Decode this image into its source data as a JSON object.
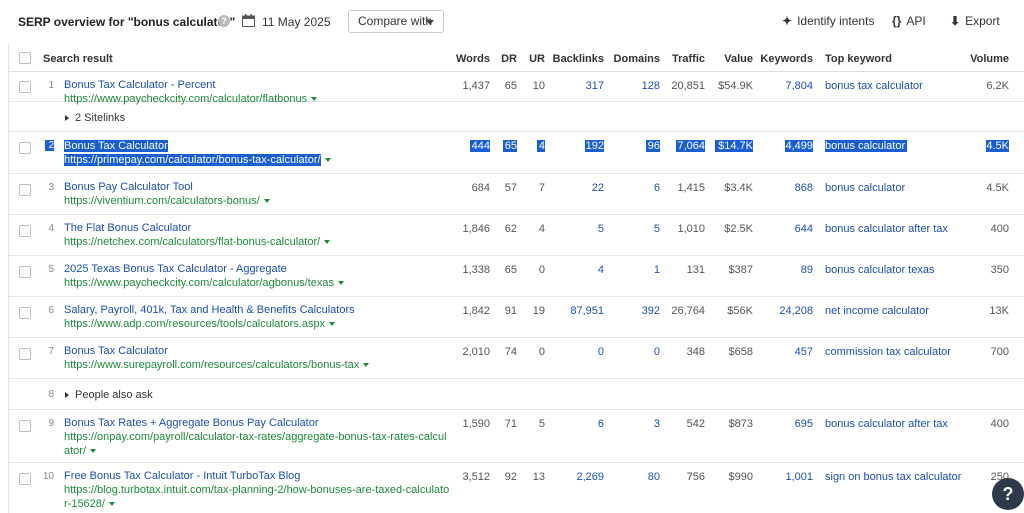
{
  "header": {
    "title": "SERP overview for \"bonus calculator\"",
    "help_icon": "?",
    "date": "11 May 2025",
    "compare_label": "Compare with",
    "identify_label": "Identify intents",
    "api_label": "API",
    "export_label": "Export"
  },
  "columns": {
    "result": "Search result",
    "words": "Words",
    "dr": "DR",
    "ur": "UR",
    "backlinks": "Backlinks",
    "domains": "Domains",
    "traffic": "Traffic",
    "value": "Value",
    "keywords": "Keywords",
    "top_keyword": "Top keyword",
    "volume": "Volume"
  },
  "rows": [
    {
      "rank": "1",
      "title": "Bonus Tax Calculator - Percent",
      "url": "https://www.paycheckcity.com/calculator/flatbonus",
      "words": "1,437",
      "dr": "65",
      "ur": "10",
      "backlinks": "317",
      "domains": "128",
      "traffic": "20,851",
      "value": "$54.9K",
      "keywords": "7,804",
      "top_keyword": "bonus tax calculator",
      "volume": "6.2K"
    },
    {
      "sitelinks": "2 Sitelinks"
    },
    {
      "rank": "2",
      "title": "Bonus Tax Calculator",
      "url": "https://primepay.com/calculator/bonus-tax-calculator/",
      "words": "444",
      "dr": "65",
      "ur": "4",
      "backlinks": "192",
      "domains": "96",
      "traffic": "7,064",
      "value": "$14.7K",
      "keywords": "4,499",
      "top_keyword": "bonus calculator",
      "volume": "4.5K"
    },
    {
      "rank": "3",
      "title": "Bonus Pay Calculator Tool",
      "url": "https://viventium.com/calculators-bonus/",
      "words": "684",
      "dr": "57",
      "ur": "7",
      "backlinks": "22",
      "domains": "6",
      "traffic": "1,415",
      "value": "$3.4K",
      "keywords": "868",
      "top_keyword": "bonus calculator",
      "volume": "4.5K"
    },
    {
      "rank": "4",
      "title": "The Flat Bonus Calculator",
      "url": "https://netchex.com/calculators/flat-bonus-calculator/",
      "words": "1,846",
      "dr": "62",
      "ur": "4",
      "backlinks": "5",
      "domains": "5",
      "traffic": "1,010",
      "value": "$2.5K",
      "keywords": "644",
      "top_keyword": "bonus calculator after tax",
      "volume": "400"
    },
    {
      "rank": "5",
      "title": "2025 Texas Bonus Tax Calculator - Aggregate",
      "url": "https://www.paycheckcity.com/calculator/agbonus/texas",
      "words": "1,338",
      "dr": "65",
      "ur": "0",
      "backlinks": "4",
      "domains": "1",
      "traffic": "131",
      "value": "$387",
      "keywords": "89",
      "top_keyword": "bonus calculator texas",
      "volume": "350"
    },
    {
      "rank": "6",
      "title": "Salary, Payroll, 401k, Tax and Health & Benefits Calculators",
      "url": "https://www.adp.com/resources/tools/calculators.aspx",
      "words": "1,842",
      "dr": "91",
      "ur": "19",
      "backlinks": "87,951",
      "domains": "392",
      "traffic": "26,764",
      "value": "$56K",
      "keywords": "24,208",
      "top_keyword": "net income calculator",
      "volume": "13K"
    },
    {
      "rank": "7",
      "title": "Bonus Tax Calculator",
      "url": "https://www.surepayroll.com/resources/calculators/bonus-tax",
      "words": "2,010",
      "dr": "74",
      "ur": "0",
      "backlinks": "0",
      "domains": "0",
      "traffic": "348",
      "value": "$658",
      "keywords": "457",
      "top_keyword": "commission tax calculator",
      "volume": "700"
    },
    {
      "rank": "8",
      "paa": "People also ask"
    },
    {
      "rank": "9",
      "title": "Bonus Tax Rates + Aggregate Bonus Pay Calculator",
      "url": "https://onpay.com/payroll/calculator-tax-rates/aggregate-bonus-tax-rates-calcul",
      "url2": "ator/",
      "words": "1,590",
      "dr": "71",
      "ur": "5",
      "backlinks": "6",
      "domains": "3",
      "traffic": "542",
      "value": "$873",
      "keywords": "695",
      "top_keyword": "bonus calculator after tax",
      "volume": "400"
    },
    {
      "rank": "10",
      "title": "Free Bonus Tax Calculator - Intuit TurboTax Blog",
      "url": "https://blog.turbotax.intuit.com/tax-planning-2/how-bonuses-are-taxed-calculato",
      "url2": "r-15628/",
      "words": "3,512",
      "dr": "92",
      "ur": "13",
      "backlinks": "2,269",
      "domains": "80",
      "traffic": "756",
      "value": "$990",
      "keywords": "1,001",
      "top_keyword": "sign on bonus tax calculator",
      "volume": "250"
    }
  ],
  "help_bubble": "?"
}
